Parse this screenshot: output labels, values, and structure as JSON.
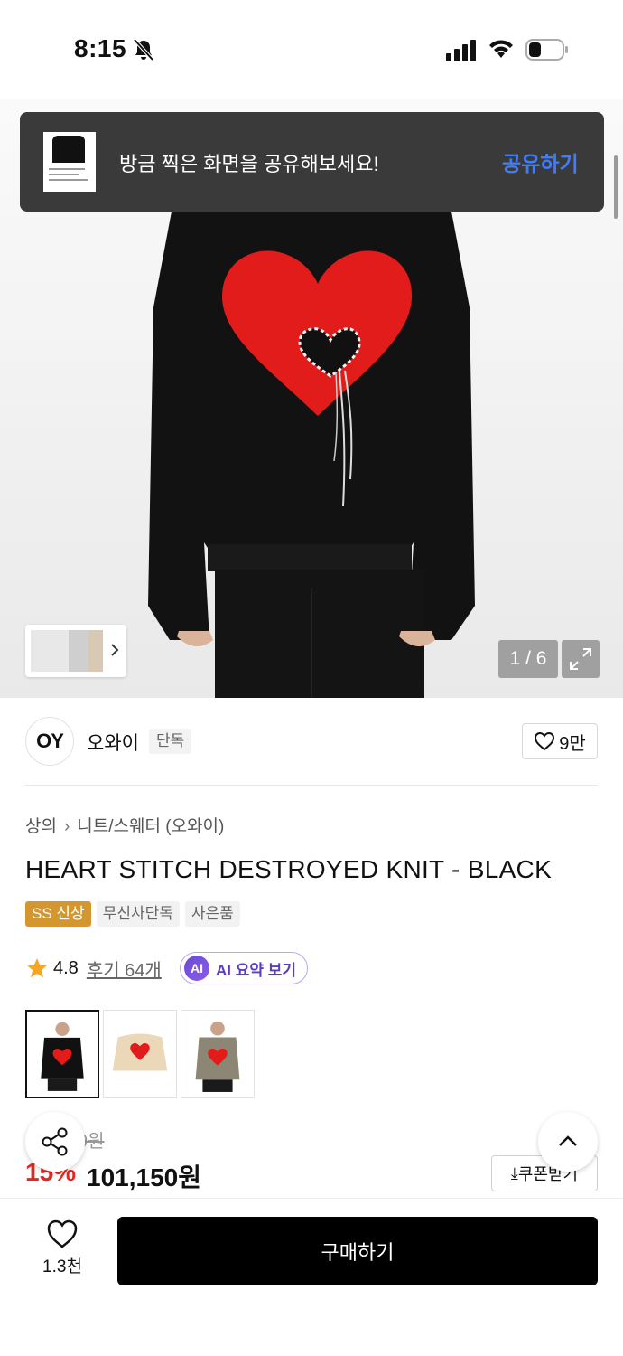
{
  "status_bar": {
    "time": "8:15"
  },
  "toast": {
    "message": "방금 찍은 화면을 공유해보세요!",
    "action": "공유하기"
  },
  "gallery": {
    "counter": "1 / 6"
  },
  "brand": {
    "logo_text": "OY",
    "name": "오와이",
    "tag": "단독",
    "likes": "9만"
  },
  "product": {
    "breadcrumb": [
      "상의",
      "니트/스웨터 (오와이)"
    ],
    "title": "HEART STITCH DESTROYED KNIT - BLACK",
    "badges": [
      "SS 신상",
      "무신사단독",
      "사은품"
    ],
    "rating": "4.8",
    "reviews": "후기 64개",
    "ai_badge": "AI",
    "ai_summary": "AI 요약 보기"
  },
  "price": {
    "original": "9원",
    "discount": "15%",
    "sale": "101,150원",
    "coupon": "쿠폰받기"
  },
  "bottom_bar": {
    "wish_count": "1.3천",
    "buy_label": "구매하기"
  },
  "colors": {
    "accent": "#3f7ef7",
    "discount": "#e6261f",
    "heart": "#e21b1b",
    "new_badge": "#d4962f"
  }
}
